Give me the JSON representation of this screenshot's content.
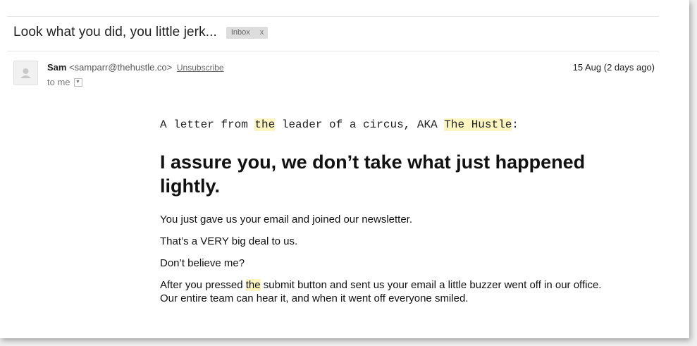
{
  "email": {
    "subject": "Look what you did, you little jerk...",
    "label_badge": "Inbox",
    "label_remove": "x",
    "sender_name": "Sam",
    "sender_email": "<samparr@thehustle.co>",
    "unsubscribe": "Unsubscribe",
    "to_text": "to me",
    "to_caret": "▼",
    "date": "15 Aug (2 days ago)"
  },
  "body": {
    "letter_prefix": "A letter from ",
    "letter_the": "the",
    "letter_middle": " leader of a circus, AKA ",
    "letter_hustle": "The Hustle",
    "letter_suffix": ":",
    "headline": "I assure you, we don’t take what just happened lightly.",
    "p1": "You just gave us your email and joined our newsletter.",
    "p2": "That’s a VERY big deal to us.",
    "p3": "Don’t believe me?",
    "p4_start": "After you pressed ",
    "p4_the": "the",
    "p4_end": " submit button and sent us your email a little buzzer went off in our office. Our entire team can hear it, and when it went off everyone smiled."
  },
  "colors": {
    "highlight": "#fcf5c1",
    "badge_bg": "#dddddd"
  },
  "icons": {
    "avatar": "default-person-avatar-icon"
  }
}
